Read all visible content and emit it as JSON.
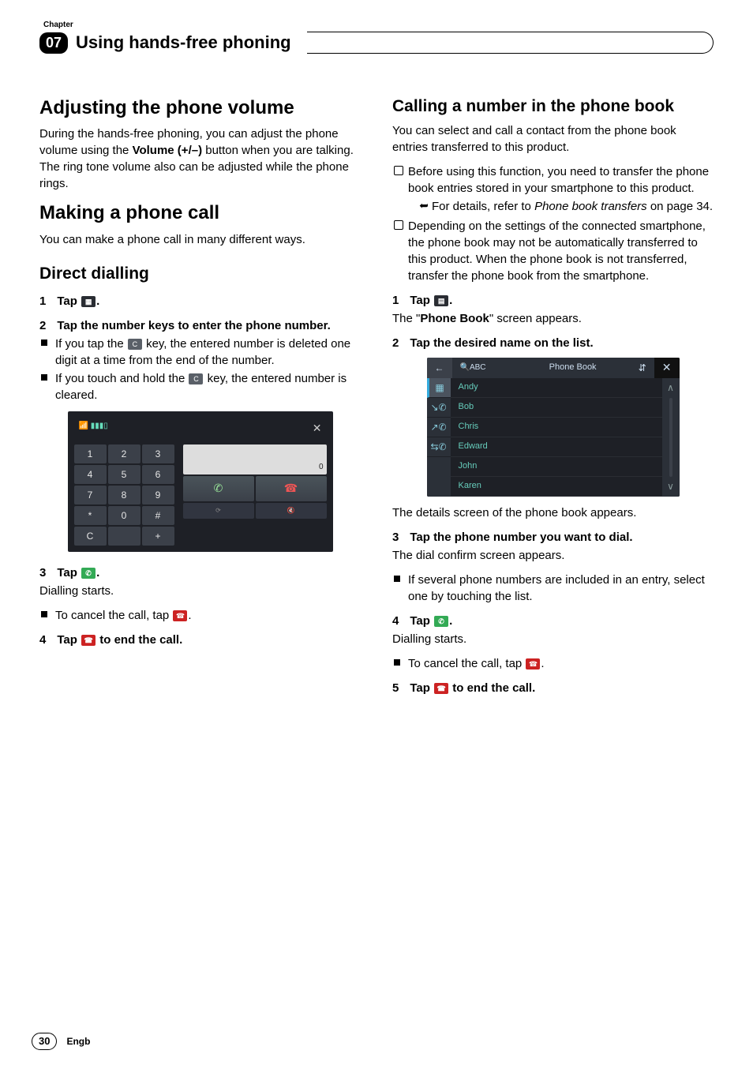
{
  "chapter": {
    "label": "Chapter",
    "number": "07",
    "title": "Using hands-free phoning"
  },
  "left": {
    "h_adjust": "Adjusting the phone volume",
    "p_adjust": "During the hands-free phoning, you can adjust the phone volume using the ",
    "p_adjust_bold": "Volume (+/–)",
    "p_adjust_2": " button when you are talking. The ring tone volume also can be adjusted while the phone rings.",
    "h_make": "Making a phone call",
    "p_make": "You can make a phone call in many different ways.",
    "h_direct": "Direct dialling",
    "s1": "Tap ",
    "s1_end": ".",
    "s2": "Tap the number keys to enter the phone number.",
    "s2_b1_a": "If you tap the ",
    "s2_b1_b": " key, the entered number is deleted one digit at a time from the end of the number.",
    "s2_b2_a": "If you touch and hold the ",
    "s2_b2_b": " key, the entered number is cleared.",
    "s3": "Tap ",
    "s3_end": ".",
    "s3_p": "Dialling starts.",
    "s3_b1": "To cancel the call, tap ",
    "s3_b1_end": ".",
    "s4_a": "Tap ",
    "s4_b": " to end the call."
  },
  "right": {
    "h_call": "Calling a number in the phone book",
    "p_intro": "You can select and call a contact from the phone book entries transferred to this product.",
    "n1": "Before using this function, you need to transfer the phone book entries stored in your smartphone to this product.",
    "n1_sub_a": "For details, refer to ",
    "n1_sub_b": "Phone book transfers",
    "n1_sub_c": " on page 34.",
    "n2": "Depending on the settings of the connected smartphone, the phone book may not be automatically transferred to this product. When the phone book is not transferred, transfer the phone book from the smartphone.",
    "s1": "Tap ",
    "s1_end": ".",
    "s1_p_a": "The \"",
    "s1_p_b": "Phone Book",
    "s1_p_c": "\" screen appears.",
    "s2": "Tap the desired name on the list.",
    "s2_p": "The details screen of the phone book appears.",
    "s3": "Tap the phone number you want to dial.",
    "s3_p": "The dial confirm screen appears.",
    "s3_b1": "If several phone numbers are included in an entry, select one by touching the list.",
    "s4": "Tap ",
    "s4_end": ".",
    "s4_p": "Dialling starts.",
    "s4_b1": "To cancel the call, tap ",
    "s4_b1_end": ".",
    "s5_a": "Tap ",
    "s5_b": " to end the call."
  },
  "dialpad": {
    "status": "📶 ▮▮▮▯",
    "close": "✕",
    "keys": [
      "1",
      "2",
      "3",
      "4",
      "5",
      "6",
      "7",
      "8",
      "9",
      "*",
      "0",
      "#",
      "C",
      "",
      "+"
    ],
    "display": "0",
    "call": "✆",
    "end": "☎",
    "bot1": "⟳",
    "bot2": "🔇"
  },
  "phonebook": {
    "back": "←",
    "search_icon": "🔍",
    "search_placeholder": "ABC",
    "title": "Phone Book",
    "sort": "⇵",
    "close": "✕",
    "tabs_icons": [
      "▦",
      "↘✆",
      "↗✆",
      "⇆✆"
    ],
    "items": [
      "Andy",
      "Bob",
      "Chris",
      "Edward",
      "John",
      "Karen"
    ],
    "up": "∧",
    "down": "∨"
  },
  "footer": {
    "page": "30",
    "lang": "Engb"
  },
  "icons": {
    "keypad": "▦",
    "clear": "C",
    "call": "✆",
    "hangup": "☎",
    "book": "▤"
  }
}
